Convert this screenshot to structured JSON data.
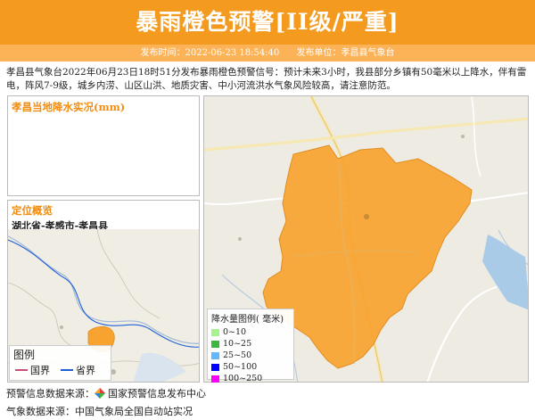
{
  "header": {
    "title": "暴雨橙色预警[II级/严重]",
    "publish_time_label": "发布时间：2022-06-23 18:54:40",
    "publish_unit_label": "发布单位：孝昌县气象台",
    "bg_color": "#f39a1f"
  },
  "description": "孝昌县气象台2022年06月23日18时51分发布暴雨橙色预警信号：预计未来3小时，我县部分乡镇有50毫米以上降水，伴有雷电，阵风7-9级，城乡内涝、山区山洪、地质灾害、中小河流洪水气象风险较高，请注意防范。",
  "rain_panel": {
    "title": "孝昌当地降水实况(mm)"
  },
  "locate_panel": {
    "title": "定位概览",
    "location": "湖北省-孝感市-孝昌县",
    "legend": {
      "title": "图例",
      "items": [
        {
          "label": "国界",
          "color": "#c8507a"
        },
        {
          "label": "省界",
          "color": "#1f5fd6"
        }
      ]
    }
  },
  "rain_legend": {
    "title": "降水量图例( 毫米)",
    "items": [
      {
        "label": "0~10",
        "color": "#a6f28f"
      },
      {
        "label": "10~25",
        "color": "#3db83d"
      },
      {
        "label": "25~50",
        "color": "#61b8ff"
      },
      {
        "label": "50~100",
        "color": "#0000fe"
      },
      {
        "label": "100~250",
        "color": "#fa00fa"
      }
    ]
  },
  "footer": {
    "warning_source": "预警信息数据来源：",
    "warning_source_name": "国家预警信息发布中心",
    "weather_source": "气象数据来源：中国气象局全国自动站实况"
  },
  "warning_area_color": "#f8a32f"
}
